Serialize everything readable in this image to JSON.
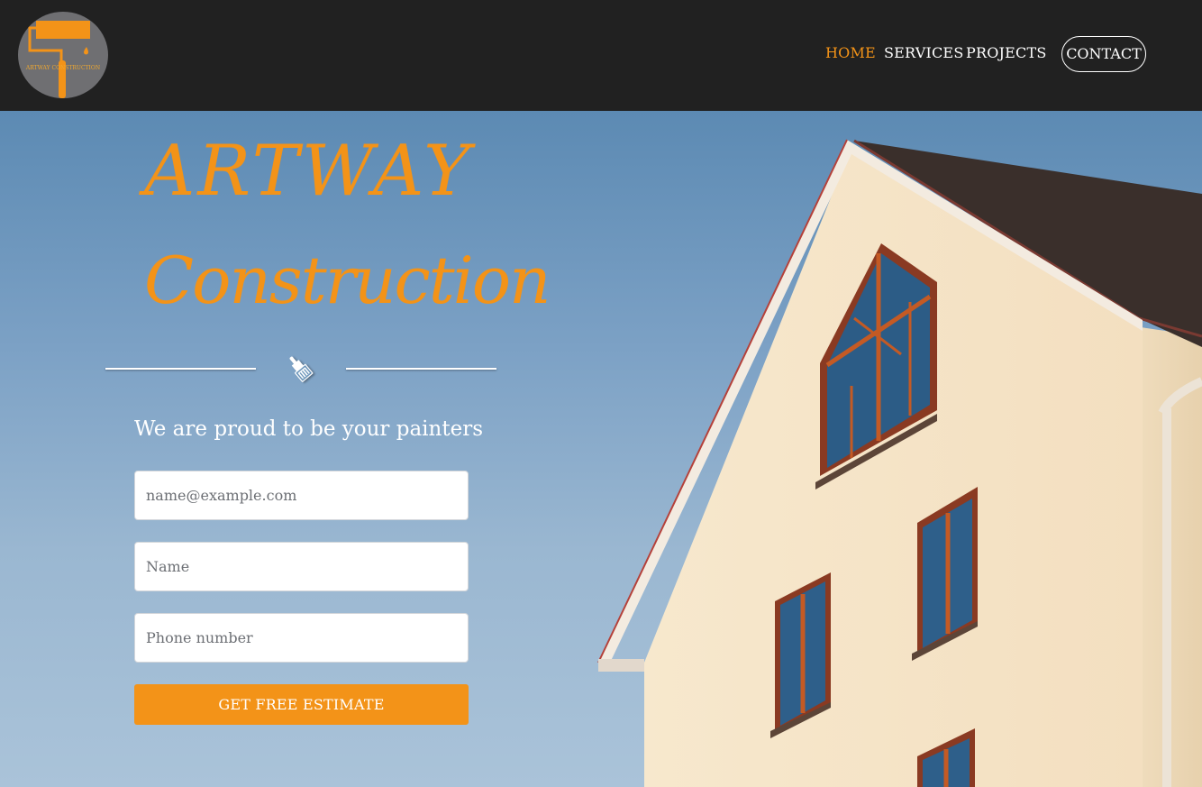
{
  "header": {
    "logo_text": "ARTWAY CONSTRUCTION",
    "nav": {
      "home": "HOME",
      "services": "SERVICES",
      "projects": "PROJECTS",
      "contact": "CONTACT"
    }
  },
  "hero": {
    "title_line1": "ARTWAY",
    "title_line2": "Construction",
    "tagline": "We are proud to be your painters"
  },
  "form": {
    "email_placeholder": "name@example.com",
    "name_placeholder": "Name",
    "phone_placeholder": "Phone number",
    "submit_label": "GET FREE ESTIMATE"
  },
  "colors": {
    "accent": "#f39318",
    "navbar": "#212121",
    "sky": "#7ca1c5"
  },
  "icons": [
    "paint-roller-icon",
    "paint-brush-icon"
  ]
}
